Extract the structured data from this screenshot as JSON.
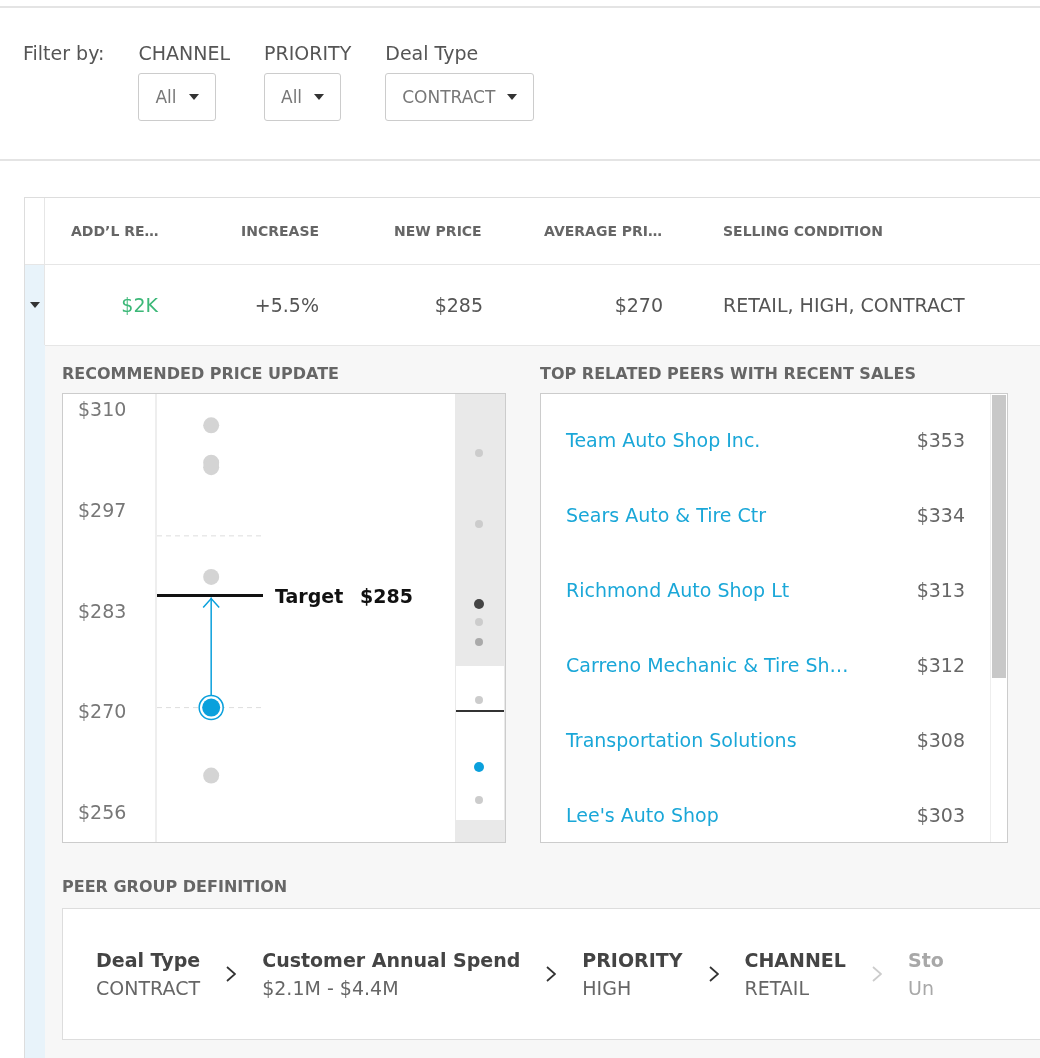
{
  "filters": {
    "label": "Filter by:",
    "dropdowns": [
      {
        "label": "CHANNEL",
        "value": "All"
      },
      {
        "label": "PRIORITY",
        "value": "All"
      },
      {
        "label": "Deal Type",
        "value": "CONTRACT"
      }
    ]
  },
  "table": {
    "columns": [
      "ADD’L RE…",
      "INCREASE",
      "NEW PRICE",
      "AVERAGE PRI…",
      "SELLING CONDITION"
    ],
    "rows": [
      {
        "expanded": true,
        "cells": [
          "$2K",
          "+5.5%",
          "$285",
          "$270",
          "RETAIL, HIGH, CONTRACT"
        ]
      }
    ]
  },
  "recommended_price": {
    "title": "RECOMMENDED PRICE UPDATE",
    "axis_labels": [
      "$310",
      "$297",
      "$283",
      "$270",
      "$256"
    ],
    "target_label": "Target",
    "target_value": "$285"
  },
  "peers": {
    "title": "TOP RELATED PEERS WITH RECENT SALES",
    "items": [
      {
        "name": "Team Auto Shop Inc.",
        "price": "$353"
      },
      {
        "name": "Sears Auto & Tire Ctr",
        "price": "$334"
      },
      {
        "name": "Richmond Auto Shop Lt",
        "price": "$313"
      },
      {
        "name": "Carreno Mechanic & Tire Sh…",
        "price": "$312"
      },
      {
        "name": "Transportation Solutions",
        "price": "$308"
      },
      {
        "name": "Lee's Auto Shop",
        "price": "$303"
      }
    ]
  },
  "peer_group": {
    "title": "PEER GROUP DEFINITION",
    "steps": [
      {
        "name": "Deal Type",
        "value": "CONTRACT",
        "disabled": false
      },
      {
        "name": "Customer Annual Spend",
        "value": "$2.1M - $4.4M",
        "disabled": false
      },
      {
        "name": "PRIORITY",
        "value": "HIGH",
        "disabled": false
      },
      {
        "name": "CHANNEL",
        "value": "RETAIL",
        "disabled": false
      },
      {
        "name": "Sto",
        "value": "Un",
        "disabled": true
      }
    ]
  }
}
